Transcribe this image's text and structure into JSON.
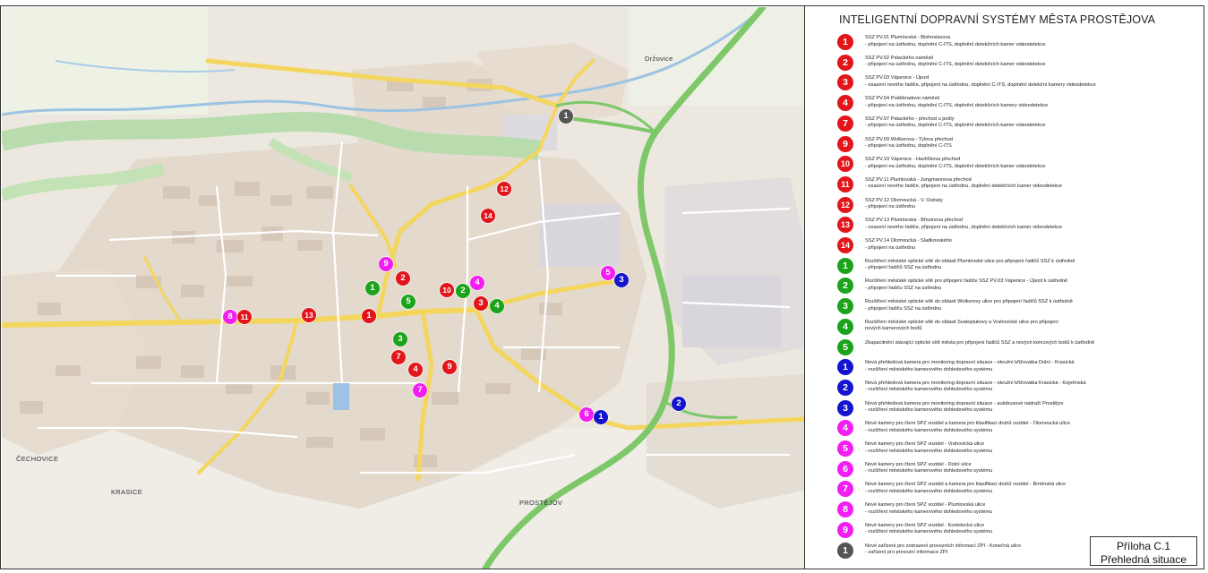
{
  "title": "INTELIGENTNÍ DOPRAVNÍ SYSTÉMY MĚSTA PROSTĚJOVA",
  "stamp": {
    "line1": "Příloha   C.1",
    "line2": "Přehledná situace"
  },
  "colors": {
    "red": "#e2151b",
    "green": "#1ba31b",
    "blue": "#1414cf",
    "magenta": "#f21df2",
    "gray": "#555555"
  },
  "place_labels": [
    {
      "id": "drzovice",
      "text": "Držovice"
    },
    {
      "id": "cechovice",
      "text": "ČECHOVICE"
    },
    {
      "id": "krasice",
      "text": "KRASICE"
    },
    {
      "id": "prostejov",
      "text": "PROSTĚJOV"
    }
  ],
  "legend": [
    {
      "label": "1",
      "color": "red",
      "line1": "SSZ PV.01 Plumlovská - Bishoslavova",
      "line2": "- připojení na ústřednu, doplnění C-ITS, doplnění detekčních kamer videodetekce"
    },
    {
      "label": "2",
      "color": "red",
      "line1": "SSZ PV.02 Palackého náměstí",
      "line2": "- připojení na ústřednu, doplnění C-ITS, doplnění detekčních kamer videodetekce"
    },
    {
      "label": "3",
      "color": "red",
      "line1": "SSZ PV.03 Vápenice - Újezd",
      "line2": "- osazení nového řadiče, připojení na ústřednu, doplnění C-ITS, doplnění detekční kamery videodetekce"
    },
    {
      "label": "4",
      "color": "red",
      "line1": "SSZ PV.04 Poděbradovo náměstí",
      "line2": "- připojení na ústřednu, doplnění C-ITS, doplnění detekčních kamery videodetekce"
    },
    {
      "label": "7",
      "color": "red",
      "line1": "SSZ PV.07 Palackého - přechod u pošty",
      "line2": "- připojení na ústřednu, doplnění C-ITS, doplnění detekčních kamer videodetekce"
    },
    {
      "label": "9",
      "color": "red",
      "line1": "SSZ PV.09 Wolkerova - Tylova přechod",
      "line2": "- připojení na ústřednu, doplnění C-ITS"
    },
    {
      "label": "10",
      "color": "red",
      "line1": "SSZ PV.10 Vápenice - Havlíčkova přechod",
      "line2": "- připojení na ústřednu, doplnění C-ITS, doplnění detekčních kamer videodetekce"
    },
    {
      "label": "11",
      "color": "red",
      "line1": "SSZ PV.11 Plumlovská - Jungmannova přechod",
      "line2": "- osazení nového řadiče, připojení na ústřednu, doplnění detekčních kamer videodetekce"
    },
    {
      "label": "12",
      "color": "red",
      "line1": "SSZ PV.12 Olomoucká - V. Outraty",
      "line2": "- připojení na ústřednu"
    },
    {
      "label": "13",
      "color": "red",
      "line1": "SSZ PV.13 Plumlovská - Březinova přechod",
      "line2": "- osazení nového řadiče, připojení na ústřednu, doplnění detekčních kamer videodetekce"
    },
    {
      "label": "14",
      "color": "red",
      "line1": "SSZ PV.14 Olomoucká - Sladkovského",
      "line2": "- připojení na ústřednu"
    },
    {
      "label": "1",
      "color": "green",
      "line1": "Rozšíření městské optické sítě do oblasti Plumlovské ulice pro připojení řadičů SSZ k ústředně",
      "line2": "- připojení řadičů SSZ na ústřednu"
    },
    {
      "label": "2",
      "color": "green",
      "line1": "Rozšíření městské optické sítě pro připojení řadiče SSZ PV.03 Vápenice - Újezd k ústředně",
      "line2": "- připojení řadiču SSZ na ústřednu"
    },
    {
      "label": "3",
      "color": "green",
      "line1": "Rozšíření městské optické sítě do oblasti Wolkerovy ulice pro připojení řadičů SSZ k ústředně",
      "line2": "- připojení řadiču SSZ na ústřednu"
    },
    {
      "label": "4",
      "color": "green",
      "line1": "Rozšíření městské optické sítě do oblasti Svatoplukovy a Vrahovické ulice pro připojení",
      "line2": "nových kamerových bodů"
    },
    {
      "label": "5",
      "color": "green",
      "line1": "Zkapacitnění stávající optické sítě města pro připojení řadičů SSZ a nových koncových bodů k ústředně",
      "line2": ""
    },
    {
      "label": "1",
      "color": "blue",
      "line1": "Nová přehledová kamera pro monitoring dopravní situace - okružní křižovatka Dolní - Krasická",
      "line2": "- rozšíření městského kamerového dohledového systému"
    },
    {
      "label": "2",
      "color": "blue",
      "line1": "Nová přehledová kamera pro monitoring dopravní situace - okružní křižovatka Krasická - Kojetínská",
      "line2": "- rozšíření městského kamerového dohledového systému"
    },
    {
      "label": "3",
      "color": "blue",
      "line1": "Nová přehledová kamera pro monitoring dopravní situace - autobusové nádraží Prostějov",
      "line2": "- rozšíření městského kamerového dohledového systému"
    },
    {
      "label": "4",
      "color": "magenta",
      "line1": "Nové kamery pro čtení SPZ vozidel a kamera pro klasifikaci druhů vozidel - Olomoucká ulice",
      "line2": "- rozšíření městského kamerového dohledového systému"
    },
    {
      "label": "5",
      "color": "magenta",
      "line1": "Nové kamery pro čtení SPZ vozidel - Vrahovická ulice",
      "line2": "- rozšíření městského kamerového dohledového systému"
    },
    {
      "label": "6",
      "color": "magenta",
      "line1": "Nové kamery pro čtení SPZ vozidel - Dolní ulice",
      "line2": "- rozšíření městského kamerového dohledového systému"
    },
    {
      "label": "7",
      "color": "magenta",
      "line1": "Nové kamery pro čtení SPZ vozidel a kamera pro klasifikaci druhů vozidel - Brněnská ulice",
      "line2": "- rozšíření městského kamerového dohledového systému"
    },
    {
      "label": "8",
      "color": "magenta",
      "line1": "Nové kamery pro čtení SPZ vozidel - Plumlovská ulice",
      "line2": "- rozšíření městského kamerového dohledového systému"
    },
    {
      "label": "9",
      "color": "magenta",
      "line1": "Nové kamery pro čtení SPZ vozidel - Kostelecká ulice",
      "line2": "- rozšíření městského kamerového dohledového systému"
    },
    {
      "label": "1",
      "color": "gray",
      "line1": "Nové zařízení pro zobrazení provozních informací ZPI - Konečná ulice",
      "line2": "- zařízení pro provozní informace ZPI"
    }
  ],
  "markers": [
    {
      "label": "1",
      "color": "gray",
      "ref": "zpi-1"
    },
    {
      "label": "12",
      "color": "red",
      "ref": "ssz-12"
    },
    {
      "label": "14",
      "color": "red",
      "ref": "ssz-14"
    },
    {
      "label": "9",
      "color": "magenta",
      "ref": "spz-9"
    },
    {
      "label": "2",
      "color": "red",
      "ref": "ssz-2"
    },
    {
      "label": "1",
      "color": "green",
      "ref": "opt-1"
    },
    {
      "label": "5",
      "color": "green",
      "ref": "opt-5"
    },
    {
      "label": "10",
      "color": "red",
      "ref": "ssz-10"
    },
    {
      "label": "2",
      "color": "green",
      "ref": "opt-2"
    },
    {
      "label": "4",
      "color": "magenta",
      "ref": "spz-4"
    },
    {
      "label": "3",
      "color": "red",
      "ref": "ssz-3"
    },
    {
      "label": "4",
      "color": "green",
      "ref": "opt-4"
    },
    {
      "label": "5",
      "color": "magenta",
      "ref": "spz-5"
    },
    {
      "label": "3",
      "color": "blue",
      "ref": "cam-3"
    },
    {
      "label": "8",
      "color": "magenta",
      "ref": "spz-8"
    },
    {
      "label": "11",
      "color": "red",
      "ref": "ssz-11"
    },
    {
      "label": "13",
      "color": "red",
      "ref": "ssz-13"
    },
    {
      "label": "1",
      "color": "red",
      "ref": "ssz-1"
    },
    {
      "label": "3",
      "color": "green",
      "ref": "opt-3"
    },
    {
      "label": "7",
      "color": "red",
      "ref": "ssz-7"
    },
    {
      "label": "4",
      "color": "red",
      "ref": "ssz-4"
    },
    {
      "label": "9",
      "color": "red",
      "ref": "ssz-9"
    },
    {
      "label": "7",
      "color": "magenta",
      "ref": "spz-7"
    },
    {
      "label": "6",
      "color": "magenta",
      "ref": "spz-6"
    },
    {
      "label": "1",
      "color": "blue",
      "ref": "cam-1"
    },
    {
      "label": "2",
      "color": "blue",
      "ref": "cam-2"
    }
  ]
}
